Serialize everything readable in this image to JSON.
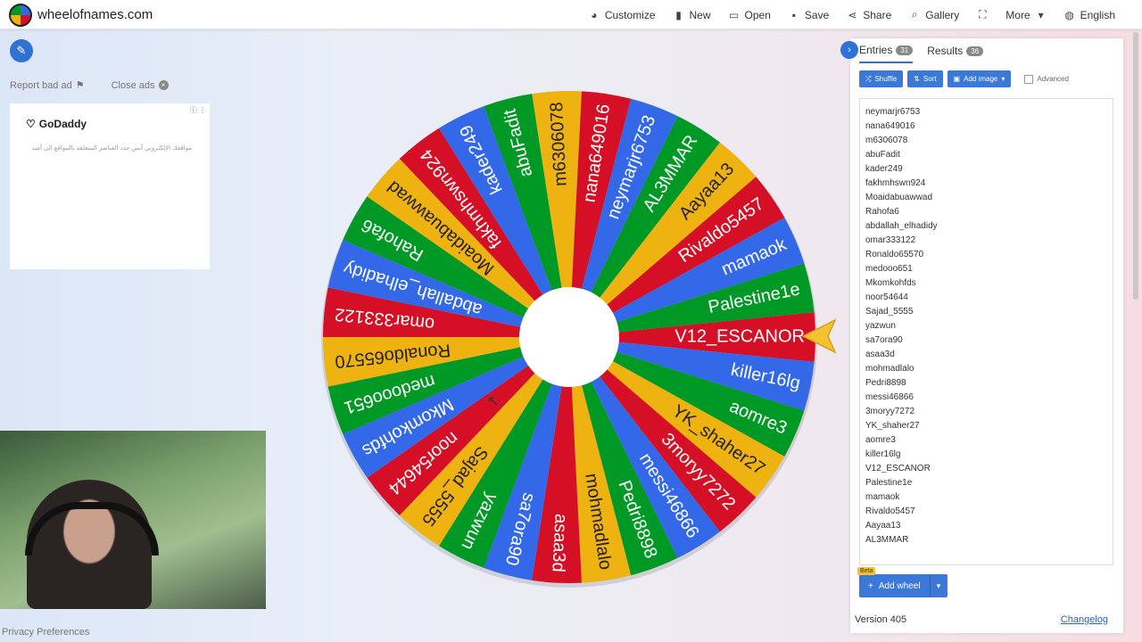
{
  "site": {
    "title": "wheelofnames.com"
  },
  "nav": [
    {
      "label": "Customize",
      "icon": "palette-icon",
      "glyph": "◕"
    },
    {
      "label": "New",
      "icon": "file-icon",
      "glyph": "▮"
    },
    {
      "label": "Open",
      "icon": "folder-open-icon",
      "glyph": "▭"
    },
    {
      "label": "Save",
      "icon": "save-icon",
      "glyph": "▪"
    },
    {
      "label": "Share",
      "icon": "share-icon",
      "glyph": "⋖"
    },
    {
      "label": "Gallery",
      "icon": "search-icon",
      "glyph": "⌕"
    },
    {
      "label": "",
      "icon": "fullscreen-icon",
      "glyph": "⛶"
    },
    {
      "label": "More",
      "icon": "chevron-down-icon",
      "glyph": "▾"
    },
    {
      "label": "English",
      "icon": "globe-icon",
      "glyph": "◍"
    }
  ],
  "left": {
    "report_bad_ad": "Report bad ad",
    "close_ads": "Close ads",
    "ad_brand": "GoDaddy",
    "ad_text": "مواقعك الإلكتروني أنس جدد العناصر المتعلقة بالمواقع الى أشد",
    "privacy": "Privacy Preferences"
  },
  "panel": {
    "tab_entries": "Entries",
    "entries_count": "31",
    "tab_results": "Results",
    "results_count": "36",
    "shuffle": "Shuffle",
    "sort": "Sort",
    "add_image": "Add image",
    "advanced": "Advanced",
    "beta": "Beta",
    "add_wheel": "Add wheel",
    "version": "Version 405",
    "changelog": "Changelog"
  },
  "entries": [
    "neymarjr6753",
    "nana649016",
    "m6306078",
    "abuFadit",
    "kader249",
    "fakhmhswn924",
    "Moaidabuawwad",
    "Rahofa6",
    "abdallah_elhadidy",
    "omar333122",
    "Ronaldo65570",
    "medooo651",
    "Mkomkohfds",
    "noor54644",
    "Sajad_5555",
    "yazwun",
    "sa7ora90",
    "asaa3d",
    "mohmadlalo",
    "Pedri8898",
    "messi46866",
    "3moryy7272",
    "YK_shaher27",
    "aomre3",
    "killer16lg",
    "V12_ESCANOR",
    "Palestine1e",
    "mamaok",
    "Rivaldo5457",
    "Aayaa13",
    "AL3MMAR"
  ],
  "wheel": {
    "segments": [
      "V12_ESCANOR",
      "killer16lg",
      "aomre3",
      "YK_shaher27",
      "3moryy7272",
      "messi46866",
      "Pedri8898",
      "mohmadlalo",
      "asaa3d",
      "sa7ora90",
      "yazwun",
      "Sajad_5555",
      "noor54644",
      "Mkomkohfds",
      "medooo651",
      "Ronaldo65570",
      "omar333122",
      "abdallah_elhadidy",
      "Rahofa6",
      "Moaidabuawwad",
      "fakhmhswn924",
      "kader249",
      "abuFadit",
      "m6306078",
      "nana649016",
      "neymarjr6753",
      "AL3MMAR",
      "Aayaa13",
      "Rivaldo5457",
      "mamaok",
      "Palestine1e"
    ],
    "colors": [
      "#d50f25",
      "#3369e8",
      "#009925",
      "#eeb211"
    ]
  }
}
